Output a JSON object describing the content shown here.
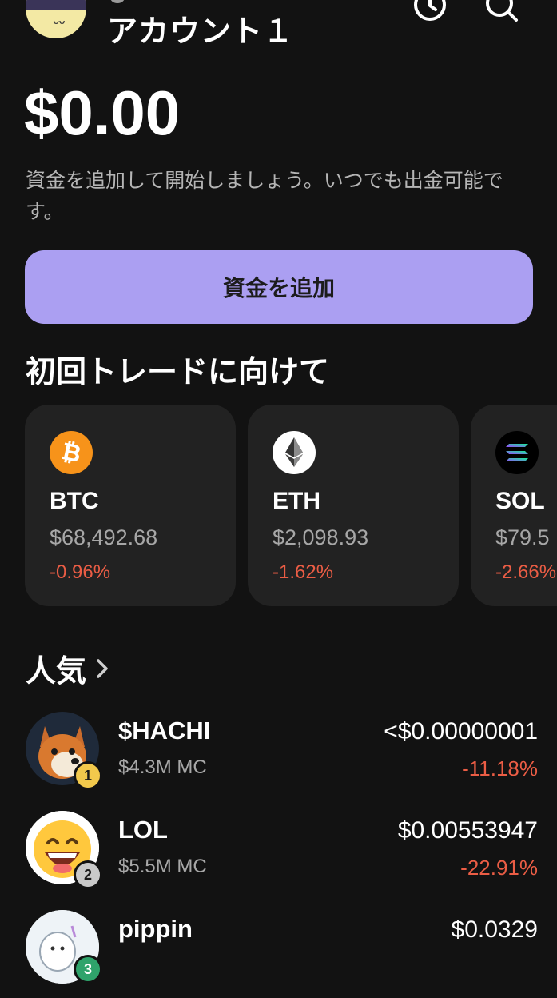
{
  "header": {
    "account_name": "アカウント１",
    "avatar_icon": "avatar-icon",
    "history_icon": "clock-icon",
    "search_icon": "search-icon"
  },
  "balance": {
    "amount": "$0.00",
    "subtitle": "資金を追加して開始しましょう。いつでも出金可能です。"
  },
  "add_funds": {
    "label": "資金を追加",
    "color": "#ab9ff2"
  },
  "first_trade": {
    "title": "初回トレードに向けて",
    "tokens": [
      {
        "symbol": "BTC",
        "price": "$68,492.68",
        "change": "-0.96%",
        "icon": "bitcoin-icon",
        "color": "#f7931a"
      },
      {
        "symbol": "ETH",
        "price": "$2,098.93",
        "change": "-1.62%",
        "icon": "ethereum-icon",
        "color": "#ffffff"
      },
      {
        "symbol": "SOL",
        "price": "$79.5",
        "change": "-2.66%",
        "icon": "solana-icon",
        "color": "#000000"
      }
    ]
  },
  "popular": {
    "title": "人気",
    "chevron_icon": "chevron-right-icon",
    "items": [
      {
        "rank": "1",
        "name": "$HACHI",
        "market_cap": "$4.3M MC",
        "price": "<$0.00000001",
        "change": "-11.18%",
        "icon": "shiba-dog-icon"
      },
      {
        "rank": "2",
        "name": "LOL",
        "market_cap": "$5.5M MC",
        "price": "$0.00553947",
        "change": "-22.91%",
        "icon": "laughing-emoji-icon"
      },
      {
        "rank": "3",
        "name": "pippin",
        "market_cap": "",
        "price": "$0.0329",
        "change": "",
        "icon": "unicorn-icon"
      }
    ]
  },
  "colors": {
    "background": "#121212",
    "card": "#222222",
    "negative": "#eb5d45",
    "muted": "#a7a7a7"
  }
}
